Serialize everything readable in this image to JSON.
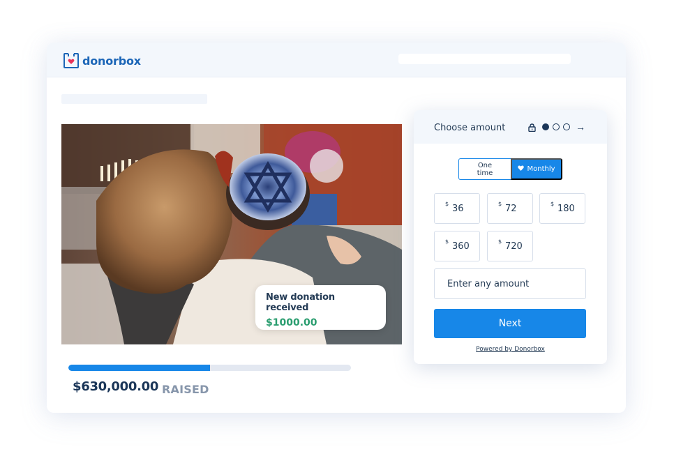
{
  "brand": {
    "name": "donorbox",
    "color": "#1c66b7",
    "heart_color": "#e8345a"
  },
  "header": {
    "logo_icon": "donorbox-box-heart-icon"
  },
  "notification": {
    "title": "New donation received",
    "amount": "$1000.00",
    "amount_color": "#2a9d6f"
  },
  "campaign": {
    "raised_amount": "$630,000.00",
    "raised_label": "RAISED",
    "progress_fraction": 0.5
  },
  "widget": {
    "title": "Choose amount",
    "icons": [
      "lock-icon",
      "step-dot-active",
      "step-dot",
      "step-dot",
      "arrow-right-icon"
    ],
    "current_step": 1,
    "total_steps": 3,
    "arrow": "→",
    "frequency": {
      "one_time_label": "One time",
      "monthly_label": "Monthly",
      "selected": "Monthly"
    },
    "currency_symbol": "$",
    "amounts": [
      "36",
      "72",
      "180",
      "360",
      "720"
    ],
    "custom_amount_placeholder": "Enter any amount",
    "next_label": "Next",
    "powered_by": "Powered by Donorbox",
    "accent_color": "#1787e8"
  }
}
